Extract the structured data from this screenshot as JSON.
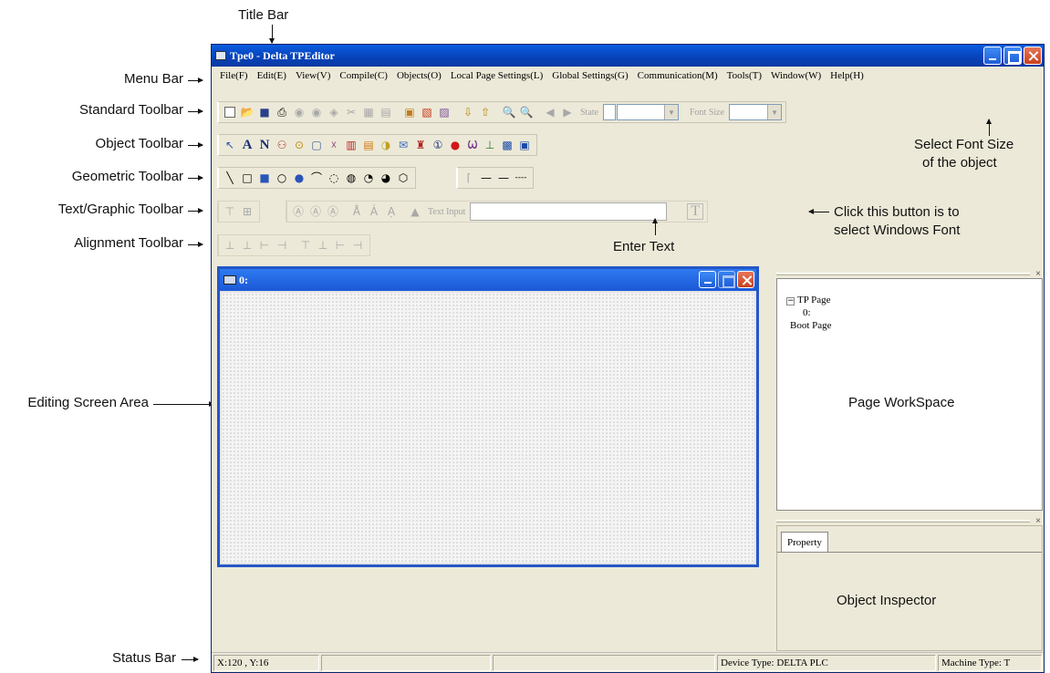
{
  "callouts": {
    "title_bar": "Title Bar",
    "menu_bar": "Menu Bar",
    "standard_toolbar": "Standard Toolbar",
    "object_toolbar": "Object Toolbar",
    "geometric_toolbar": "Geometric Toolbar",
    "text_graphic_toolbar": "Text/Graphic Toolbar",
    "alignment_toolbar": "Alignment Toolbar",
    "editing_screen_area": "Editing Screen Area",
    "status_bar": "Status Bar",
    "select_font_size_line1": "Select Font Size",
    "select_font_size_line2": "of the object",
    "windows_font_line1": "Click this button is to",
    "windows_font_line2": "select Windows Font",
    "enter_text": "Enter Text",
    "page_workspace": "Page WorkSpace",
    "object_inspector": "Object Inspector"
  },
  "window": {
    "title": "Tpe0 - Delta TPEditor"
  },
  "menu": [
    "File(F)",
    "Edit(E)",
    "View(V)",
    "Compile(C)",
    "Objects(O)",
    "Local Page Settings(L)",
    "Global Settings(G)",
    "Communication(M)",
    "Tools(T)",
    "Window(W)",
    "Help(H)"
  ],
  "toolbar": {
    "state_label": "State",
    "font_size_label": "Font Size",
    "text_input_label": "Text Input",
    "windows_font_button": "T"
  },
  "editor": {
    "child_title": "0:"
  },
  "workspace": {
    "tree_root": "TP Page",
    "tree_child": "0:",
    "tree_boot": "Boot Page"
  },
  "inspector": {
    "tab": "Property"
  },
  "status": {
    "coords": "X:120 , Y:16",
    "device_type": "Device Type: DELTA PLC",
    "machine_type": "Machine Type: T"
  }
}
